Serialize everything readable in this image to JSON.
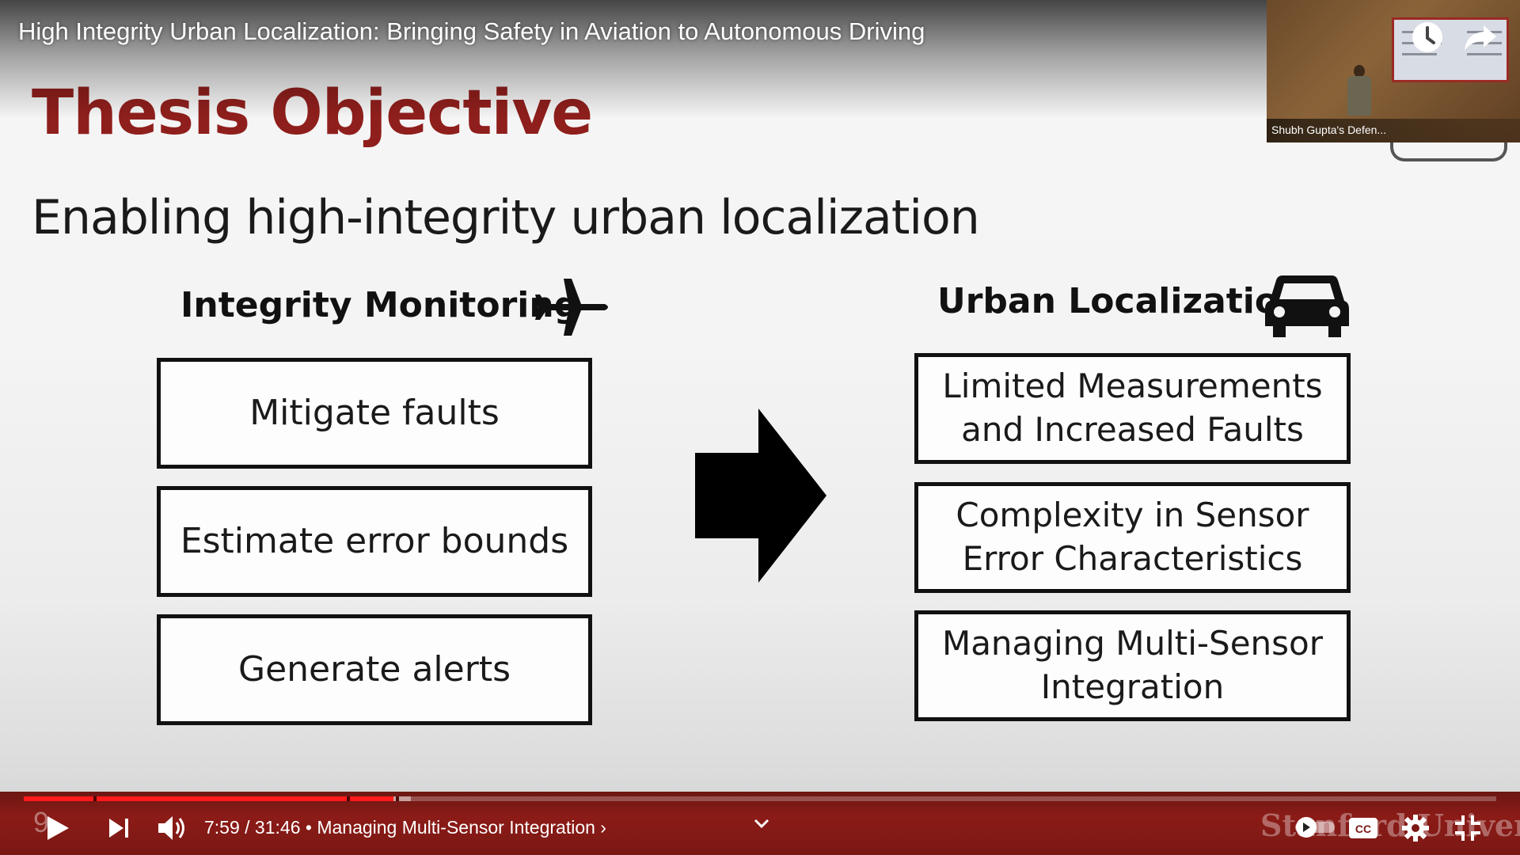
{
  "video": {
    "title": "High Integrity Urban Localization: Bringing Safety in Aviation to Autonomous Driving"
  },
  "slide": {
    "title": "Thesis Objective",
    "subtitle": "Enabling high-integrity urban localization",
    "left_column": {
      "heading": "Integrity Monitoring",
      "icon": "airplane-icon",
      "boxes": [
        "Mitigate faults",
        "Estimate error bounds",
        "Generate alerts"
      ]
    },
    "right_column": {
      "heading": "Urban Localization",
      "icon": "car-icon",
      "boxes": [
        [
          "Limited Measurements",
          "and Increased Faults"
        ],
        [
          "Complexity in Sensor",
          "Error Characteristics"
        ],
        [
          "Managing Multi-Sensor",
          "Integration"
        ]
      ]
    },
    "number_partial": "9",
    "watermark": "Stanford University"
  },
  "thumbnail": {
    "label": "Shubh Gupta's Defen..."
  },
  "player": {
    "time_current": "7:59",
    "time_total": "31:46",
    "time_text": "7:59 / 31:46 • Managing Multi-Sensor Integration ›",
    "chapter": "Managing Multi-Sensor Integration",
    "progress_played_fraction": 0.251,
    "progress_loaded_fraction": 0.263,
    "accent_color": "#ff1a1a",
    "controls": [
      "play-icon",
      "next-icon",
      "volume-icon",
      "chevron-down-icon",
      "autoplay-toggle",
      "cc-icon",
      "gear-icon",
      "exit-fullscreen-icon"
    ]
  },
  "top_actions": [
    "watch-later-icon",
    "share-icon"
  ]
}
